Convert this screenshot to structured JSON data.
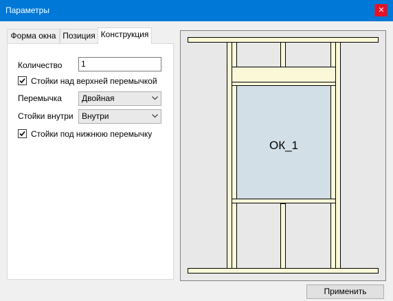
{
  "window": {
    "title": "Параметры",
    "close_glyph": "✕"
  },
  "tabs": [
    {
      "label": "Форма окна",
      "active": false
    },
    {
      "label": "Позиция",
      "active": false
    },
    {
      "label": "Конструкция",
      "active": true
    }
  ],
  "form": {
    "quantity_label": "Количество",
    "quantity_value": "1",
    "studs_above_label": "Стойки над верхней перемычкой",
    "studs_above_checked": true,
    "lintel_label": "Перемычка",
    "lintel_value": "Двойная",
    "inner_studs_label": "Стойки внутри",
    "inner_studs_value": "Внутри",
    "studs_below_label": "Стойки под нижнюю перемычку",
    "studs_below_checked": true
  },
  "preview": {
    "window_label": "ОК_1",
    "wood_color": "#fbf8d8",
    "opening_color": "#d2dfe6",
    "background_color": "#e8e8e8"
  },
  "apply_label": "Применить"
}
